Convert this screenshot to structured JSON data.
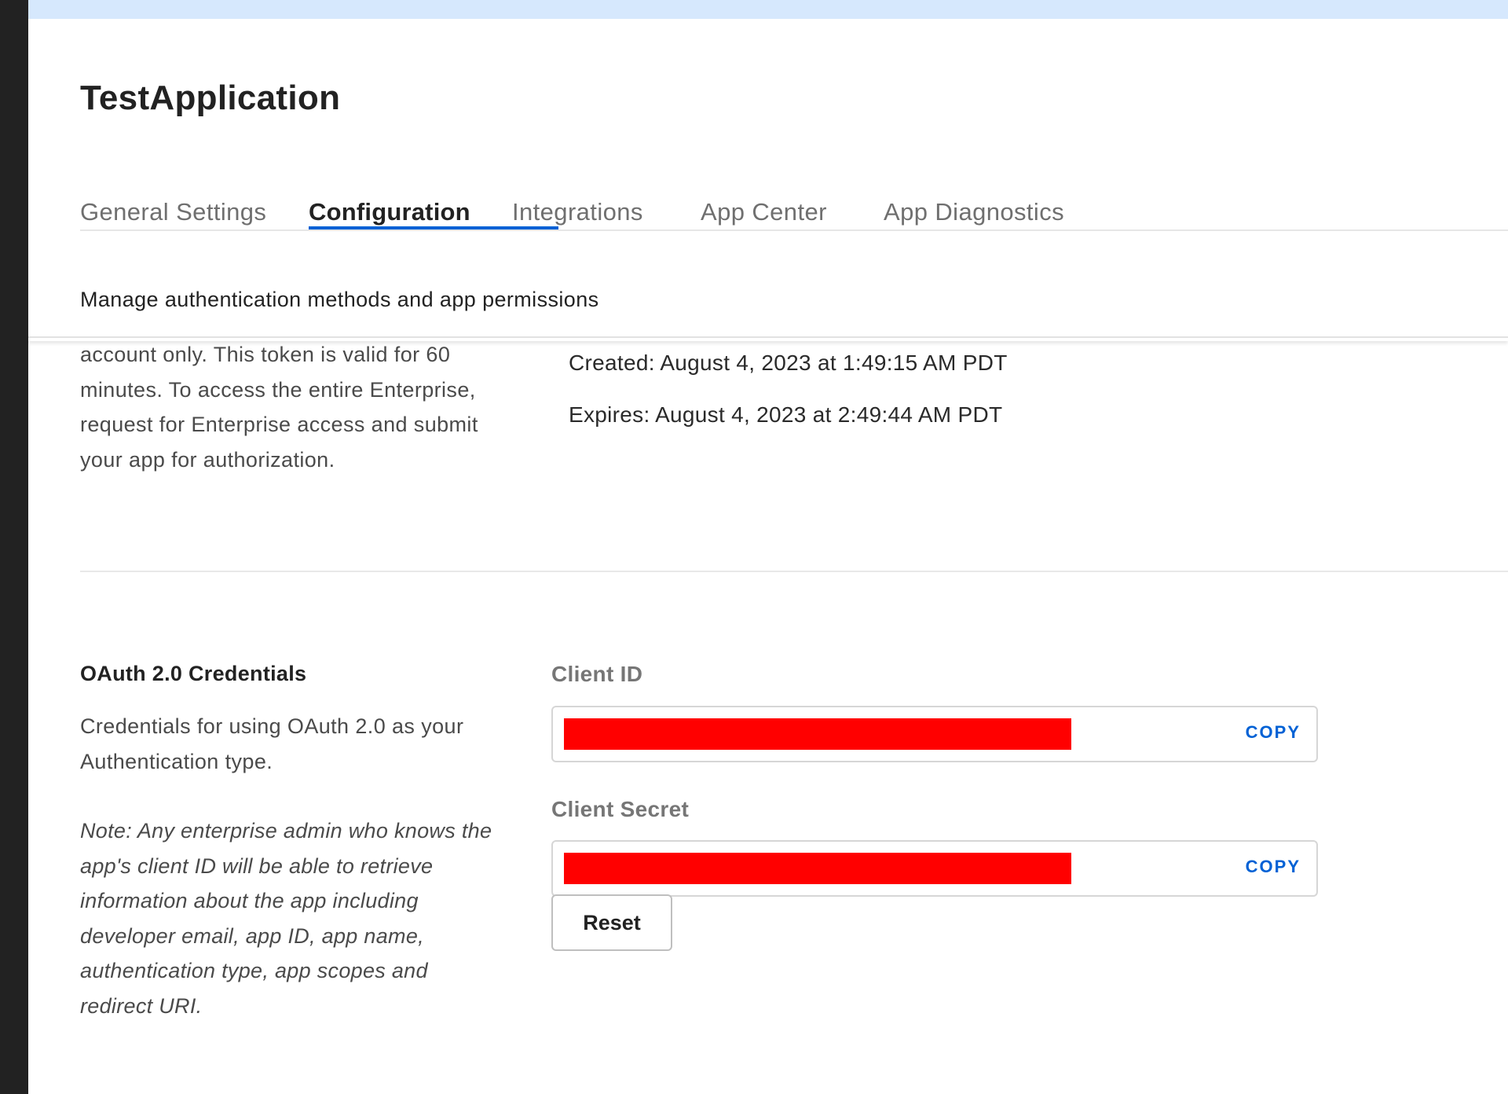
{
  "app": {
    "title": "TestApplication"
  },
  "tabs": [
    {
      "label": "General Settings",
      "active": false
    },
    {
      "label": "Configuration",
      "active": true
    },
    {
      "label": "Integrations",
      "active": false
    },
    {
      "label": "App Center",
      "active": false
    },
    {
      "label": "App Diagnostics",
      "active": false
    }
  ],
  "subtitle": "Manage authentication methods and app permissions",
  "developer_token": {
    "description": "account only. This token is valid for 60 minutes. To access the entire Enterprise, request for Enterprise access and submit your app for authorization.",
    "created": "Created: August 4, 2023 at 1:49:15 AM PDT",
    "expires": "Expires: August 4, 2023 at 2:49:44 AM PDT"
  },
  "oauth": {
    "title": "OAuth 2.0 Credentials",
    "description": "Credentials for using OAuth 2.0 as your Authentication type.",
    "note": "Note: Any enterprise admin who knows the app's client ID will be able to retrieve information about the app including developer email, app ID, app name, authentication type, app scopes and redirect URI.",
    "client_id_label": "Client ID",
    "client_secret_label": "Client Secret",
    "copy_label": "COPY",
    "reset_label": "Reset"
  },
  "colors": {
    "accent": "#0061d5",
    "redaction": "#ff0000",
    "top_strip": "#d6e8fd",
    "left_rail": "#222222"
  }
}
